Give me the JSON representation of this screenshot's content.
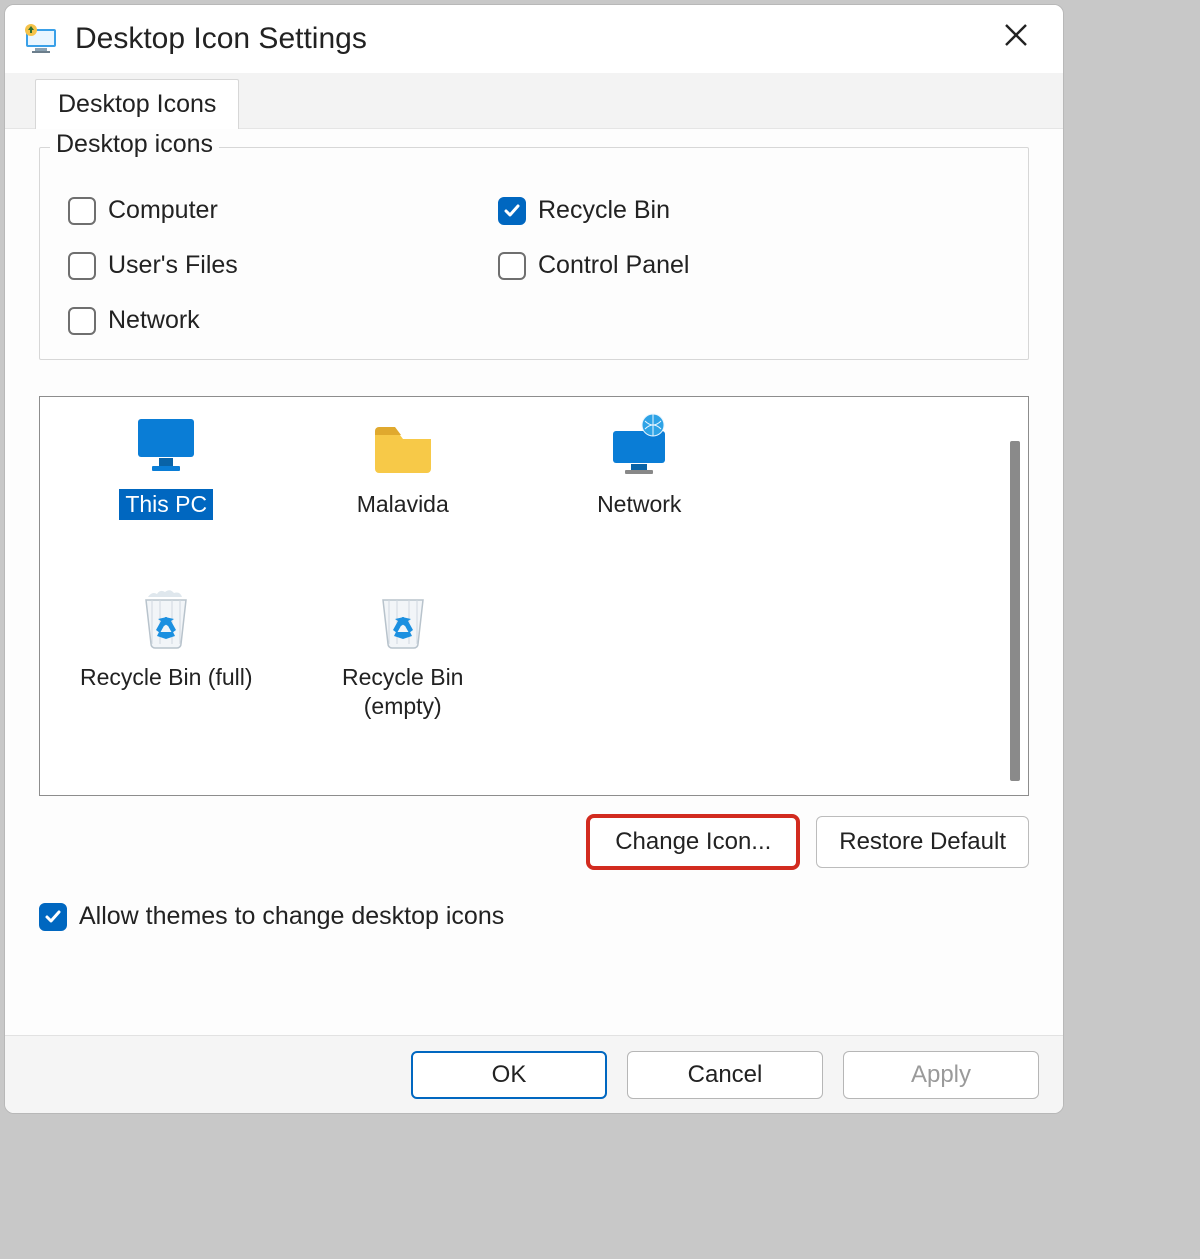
{
  "colors": {
    "accent": "#0067c0",
    "highlight": "#d22b1f"
  },
  "titlebar": {
    "title": "Desktop Icon Settings"
  },
  "tab": {
    "label": "Desktop Icons"
  },
  "group": {
    "legend": "Desktop icons",
    "items": [
      {
        "label": "Computer",
        "checked": false
      },
      {
        "label": "Recycle Bin",
        "checked": true
      },
      {
        "label": "User's Files",
        "checked": false
      },
      {
        "label": "Control Panel",
        "checked": false
      },
      {
        "label": "Network",
        "checked": false
      }
    ]
  },
  "icons": {
    "items": [
      {
        "label": "This PC",
        "icon": "monitor",
        "selected": true
      },
      {
        "label": "Malavida",
        "icon": "folder",
        "selected": false
      },
      {
        "label": "Network",
        "icon": "network",
        "selected": false
      },
      {
        "label": "Recycle Bin (full)",
        "icon": "recycle-full",
        "selected": false
      },
      {
        "label": "Recycle Bin (empty)",
        "icon": "recycle-empty",
        "selected": false
      }
    ]
  },
  "buttons": {
    "change_icon": "Change Icon...",
    "restore_default": "Restore Default"
  },
  "themes_checkbox": {
    "label": "Allow themes to change desktop icons",
    "checked": true
  },
  "dialog": {
    "ok": "OK",
    "cancel": "Cancel",
    "apply": "Apply"
  }
}
